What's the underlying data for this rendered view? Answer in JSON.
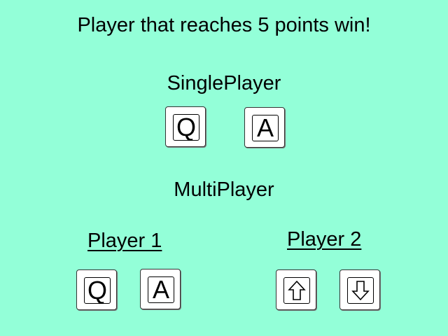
{
  "title": "Player that reaches 5 points win!",
  "singleplayer": {
    "heading": "SinglePlayer",
    "keys": [
      {
        "label": "Q",
        "icon": "key-q"
      },
      {
        "label": "A",
        "icon": "key-a"
      }
    ]
  },
  "multiplayer": {
    "heading": "MultiPlayer",
    "player1": {
      "heading": "Player 1",
      "keys": [
        {
          "label": "Q",
          "icon": "key-q"
        },
        {
          "label": "A",
          "icon": "key-a"
        }
      ]
    },
    "player2": {
      "heading": "Player 2",
      "keys": [
        {
          "icon": "arrow-up-key"
        },
        {
          "icon": "arrow-down-key"
        }
      ]
    }
  },
  "colors": {
    "background": "#93FFD8",
    "key_face": "#FFFFFF",
    "text": "#000000"
  }
}
